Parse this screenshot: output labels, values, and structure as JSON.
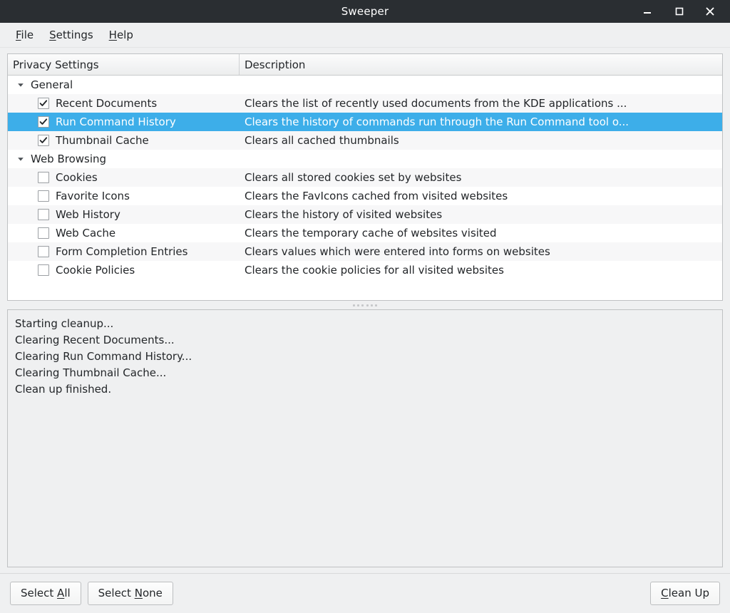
{
  "window": {
    "title": "Sweeper",
    "controls": [
      {
        "name": "minimize",
        "glyph": "minimize-icon"
      },
      {
        "name": "maximize",
        "glyph": "maximize-icon"
      },
      {
        "name": "close",
        "glyph": "close-icon"
      }
    ]
  },
  "menubar": {
    "items": [
      {
        "label": "File",
        "accel": "F"
      },
      {
        "label": "Settings",
        "accel": "S"
      },
      {
        "label": "Help",
        "accel": "H"
      }
    ]
  },
  "tree": {
    "columns": {
      "name": "Privacy Settings",
      "description": "Description"
    },
    "groups": [
      {
        "label": "General",
        "expanded": true,
        "expander_icon": "chevron-down-icon",
        "items": [
          {
            "label": "Recent Documents",
            "checked": true,
            "selected": false,
            "description": "Clears the list of recently used documents from the KDE applications ..."
          },
          {
            "label": "Run Command History",
            "checked": true,
            "selected": true,
            "description": "Clears the history of commands run through the Run Command tool o..."
          },
          {
            "label": "Thumbnail Cache",
            "checked": true,
            "selected": false,
            "description": "Clears all cached thumbnails"
          }
        ]
      },
      {
        "label": "Web Browsing",
        "expanded": true,
        "expander_icon": "chevron-down-icon",
        "items": [
          {
            "label": "Cookies",
            "checked": false,
            "selected": false,
            "description": "Clears all stored cookies set by websites"
          },
          {
            "label": "Favorite Icons",
            "checked": false,
            "selected": false,
            "description": "Clears the FavIcons cached from visited websites"
          },
          {
            "label": "Web History",
            "checked": false,
            "selected": false,
            "description": "Clears the history of visited websites"
          },
          {
            "label": "Web Cache",
            "checked": false,
            "selected": false,
            "description": "Clears the temporary cache of websites visited"
          },
          {
            "label": "Form Completion Entries",
            "checked": false,
            "selected": false,
            "description": "Clears values which were entered into forms on websites"
          },
          {
            "label": "Cookie Policies",
            "checked": false,
            "selected": false,
            "description": "Clears the cookie policies for all visited websites"
          }
        ]
      }
    ]
  },
  "log": {
    "lines": [
      "Starting cleanup...",
      "Clearing Recent Documents...",
      "Clearing Run Command History...",
      "Clearing Thumbnail Cache...",
      "Clean up finished."
    ]
  },
  "bottombar": {
    "select_all": {
      "label": "Select All",
      "accel": "A"
    },
    "select_none": {
      "label": "Select None",
      "accel": "N"
    },
    "clean_up": {
      "label": "Clean Up",
      "accel": "C"
    }
  },
  "colors": {
    "titlebar_bg": "#2a2e32",
    "window_bg": "#eff0f1",
    "selection": "#3daee9",
    "text": "#232629",
    "row_alt": "#f7f7f8",
    "border": "#bfc1c3"
  }
}
